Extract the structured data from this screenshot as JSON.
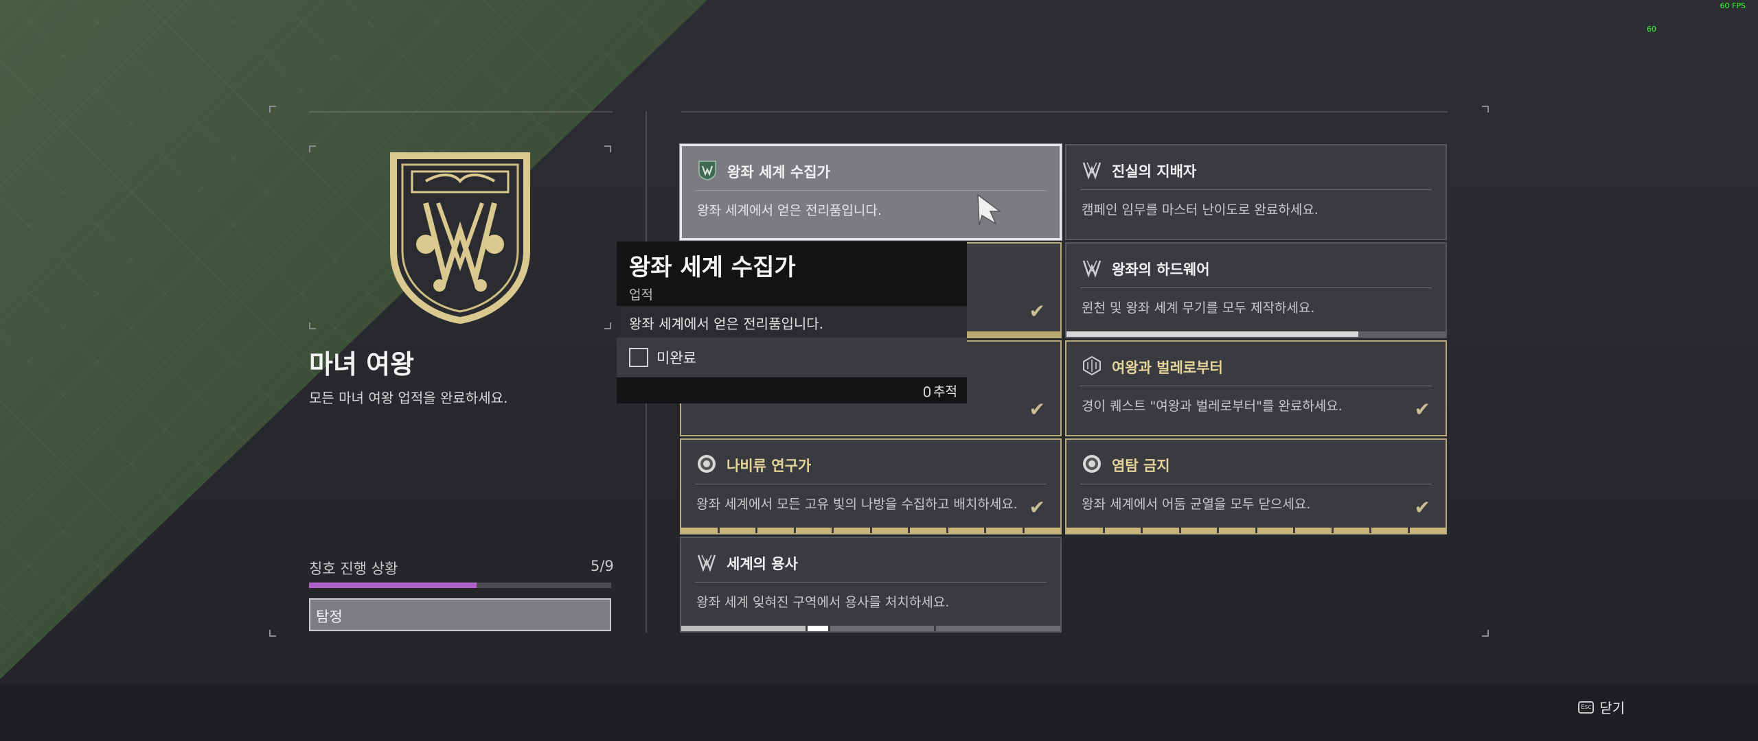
{
  "overlay": {
    "fps": "60 FPS",
    "fps_small": "60"
  },
  "title_panel": {
    "name": "마녀 여왕",
    "description": "모든 마녀 여왕 업적을 완료하세요.",
    "progress_label": "칭호 진행 상황",
    "progress_count": "5/9",
    "progress_fraction": 0.555,
    "progress_color": "#b061c8",
    "explore_button": "탐정",
    "emblem_icon": "witch-queen-emblem-icon"
  },
  "cards": [
    {
      "name": "왕좌 세계 수집가",
      "description": "왕좌 세계에서 얻은 전리품입니다.",
      "icon": "witch-queen-icon",
      "state": "selected"
    },
    {
      "name": "진실의 지배자",
      "description": "캠페인 임무를 마스터 난이도로 완료하세요.",
      "icon": "hive-sigil-icon",
      "state": "incomplete"
    },
    {
      "name": "",
      "description": "",
      "icon": "",
      "state": "complete"
    },
    {
      "name": "왕좌의 하드웨어",
      "description": "윈천 및 왕좌 세계 무기를 모두 제작하세요.",
      "icon": "hive-sigil-icon",
      "state": "partial",
      "progress_fraction": 0.77
    },
    {
      "name": "",
      "description": "",
      "icon": "",
      "state": "complete"
    },
    {
      "name": "여왕과 벌레로부터",
      "description": "경이 퀘스트 \"여왕과 벌레로부터\"를 완료하세요.",
      "icon": "exotic-quest-icon",
      "state": "complete"
    },
    {
      "name": "나비류 연구가",
      "description": "왕좌 세계에서 모든 고유 빛의 나방을 수집하고 배치하세요.",
      "icon": "lucent-moth-icon",
      "state": "complete",
      "segments": 10
    },
    {
      "name": "염탐 금지",
      "description": "왕좌 세계에서 어둠 균열을 모두 닫으세요.",
      "icon": "lucent-moth-icon",
      "state": "complete",
      "segments": 10
    },
    {
      "name": "세계의 용사",
      "description": "왕좌 세계 잊혀진 구역에서 용사를 처치하세요.",
      "icon": "hive-sigil-icon",
      "state": "partial"
    }
  ],
  "tooltip": {
    "title": "왕좌 세계 수집가",
    "type": "업적",
    "description": "왕좌 세계에서 얻은 전리품입니다.",
    "status": "미완료",
    "track_label": "추적"
  },
  "footer": {
    "close_label": "닫기",
    "esc_key": "Esc"
  }
}
